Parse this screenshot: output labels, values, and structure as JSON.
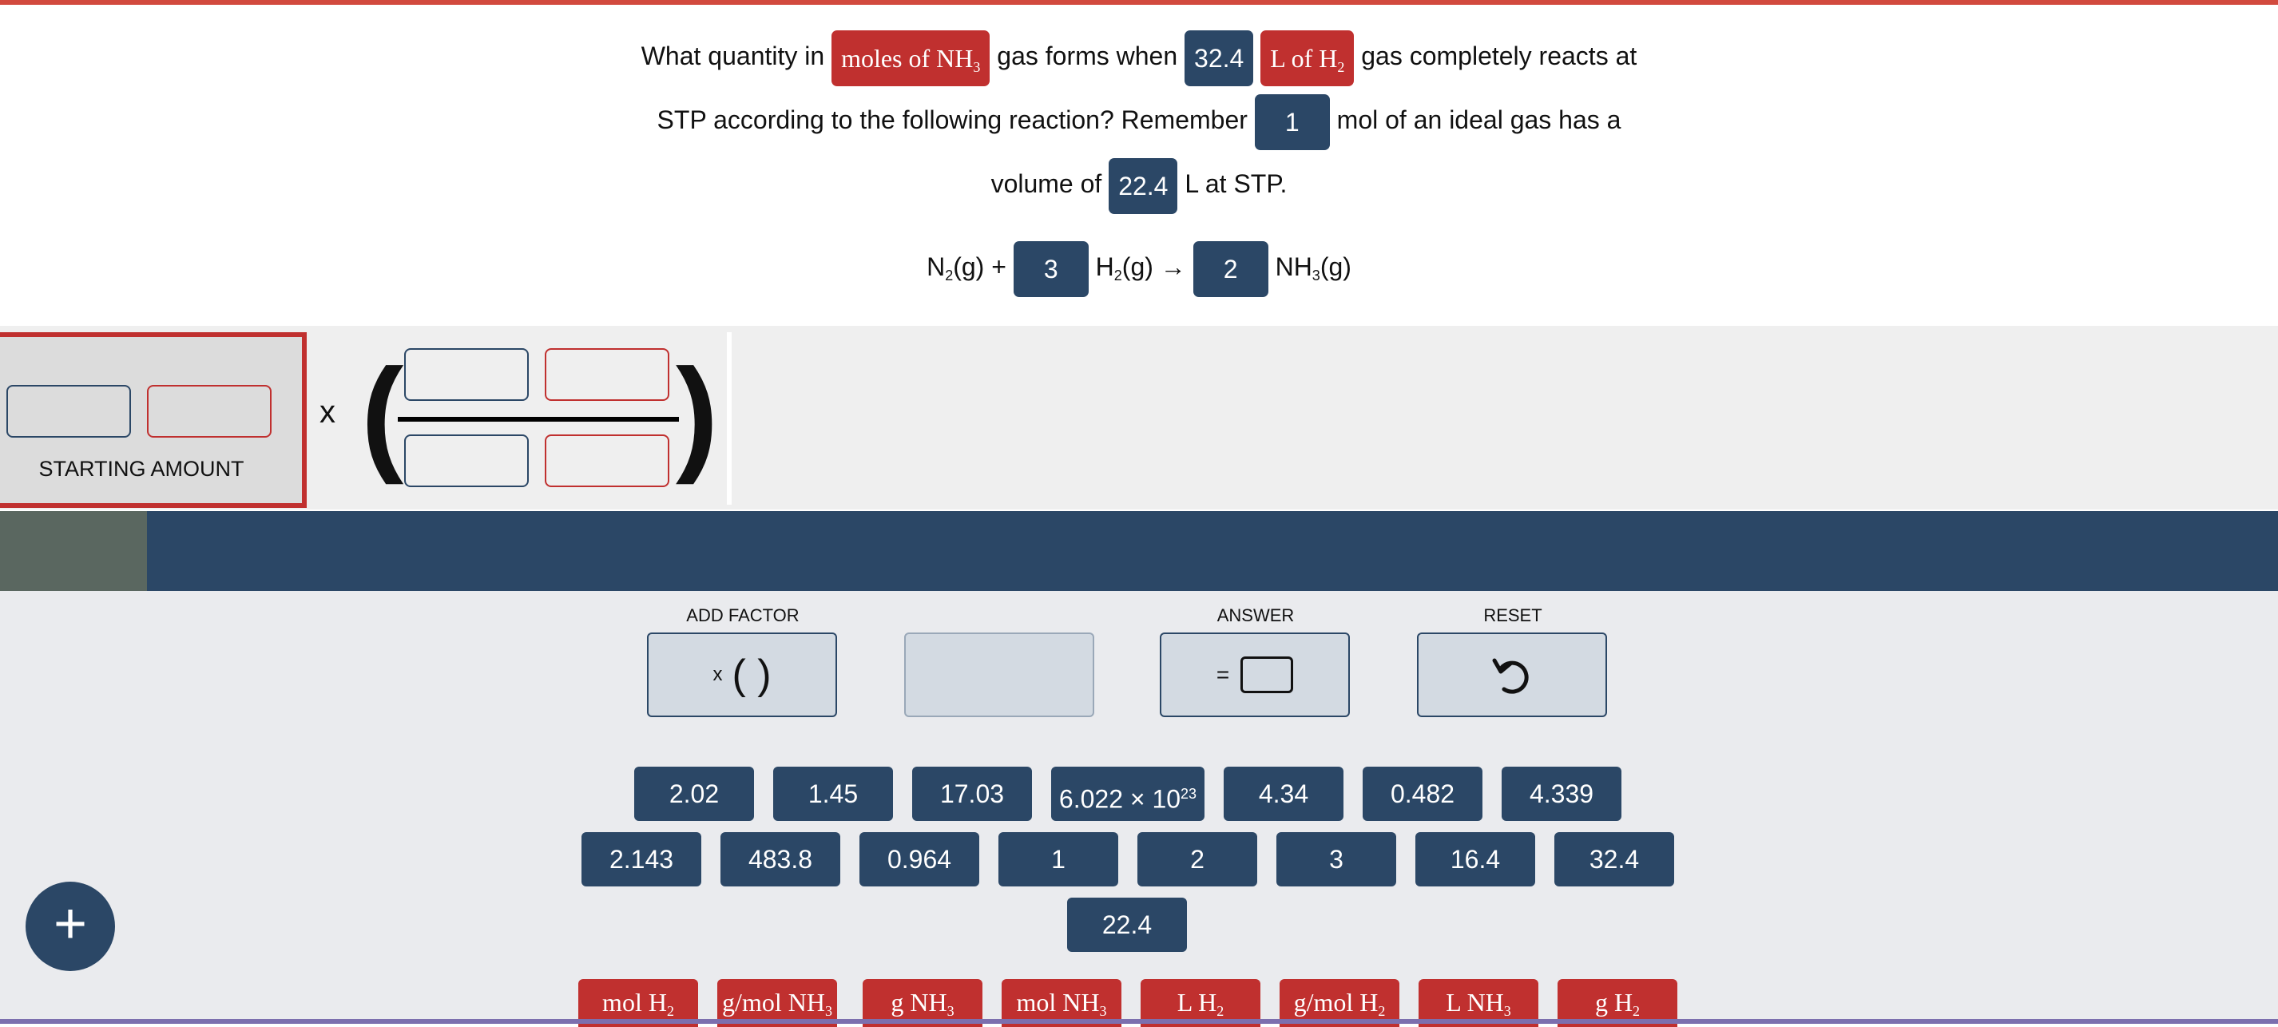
{
  "question": {
    "p1": "What quantity in",
    "chip_unit": "moles of NH",
    "chip_unit_sub": "3",
    "p2": "gas forms when",
    "chip_value": "32.4",
    "chip_unit2": "L of H",
    "chip_unit2_sub": "2",
    "p3": "gas completely reacts at",
    "p4": "STP according to the following reaction? Remember",
    "chip_mol": "1",
    "p5": "mol of an ideal gas has a",
    "p6": "volume of",
    "chip_vol": "22.4",
    "p7": "L at STP."
  },
  "reaction": {
    "r1": "N",
    "r1_sub": "2",
    "r1_rest": "(g) +",
    "coef1": "3",
    "r2": "H",
    "r2_sub": "2",
    "r2_rest": "(g) →",
    "coef2": "2",
    "p": "NH",
    "p_sub": "3",
    "p_rest": "(g)"
  },
  "workspace": {
    "starting_label": "STARTING AMOUNT",
    "times_symbol": "x",
    "paren_open": "(",
    "paren_close": ")"
  },
  "tools": {
    "add_factor_label": "ADD FACTOR",
    "add_factor_x": "x",
    "add_factor_parens": "( )",
    "answer_label": "ANSWER",
    "answer_eq": "=",
    "reset_label": "RESET",
    "reset_icon": "undo-arrow-icon"
  },
  "numbers_row1": [
    "2.02",
    "1.45",
    "17.03",
    "6.022 × 10",
    "4.34",
    "0.482",
    "4.339"
  ],
  "avogadro_exp": "23",
  "numbers_row2": [
    "2.143",
    "483.8",
    "0.964",
    "1",
    "2",
    "3",
    "16.4",
    "32.4"
  ],
  "numbers_row3": [
    "22.4"
  ],
  "units": [
    {
      "main": "mol H",
      "sub": "2"
    },
    {
      "main": "g/mol NH",
      "sub": "3"
    },
    {
      "main": "g NH",
      "sub": "3"
    },
    {
      "main": "mol NH",
      "sub": "3"
    },
    {
      "main": "L H",
      "sub": "2"
    },
    {
      "main": "g/mol H",
      "sub": "2"
    },
    {
      "main": "L NH",
      "sub": "3"
    },
    {
      "main": "g H",
      "sub": "2"
    }
  ],
  "fab": {
    "symbol": "+"
  },
  "colors": {
    "blue": "#2b4766",
    "red": "#c0302f",
    "panel": "#eaebee"
  }
}
